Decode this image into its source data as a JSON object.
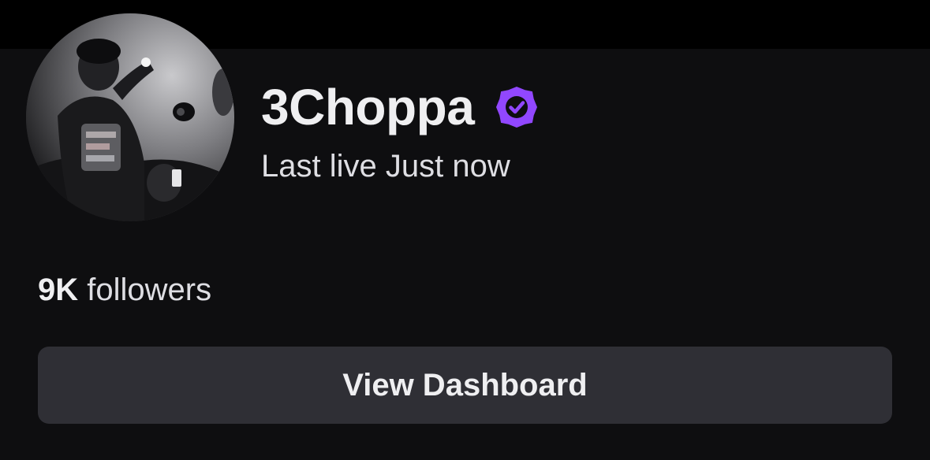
{
  "profile": {
    "display_name": "3Choppa",
    "verified_icon": "verified-badge-icon",
    "last_live": "Last live Just now",
    "followers_count": "9K",
    "followers_label": "followers"
  },
  "actions": {
    "view_dashboard_label": "View Dashboard"
  },
  "colors": {
    "background": "#0e0e10",
    "top_strip": "#000000",
    "text_primary": "#efeff1",
    "text_secondary": "#dedee3",
    "verified_purple": "#9147ff",
    "button_bg": "#2f2f35"
  }
}
